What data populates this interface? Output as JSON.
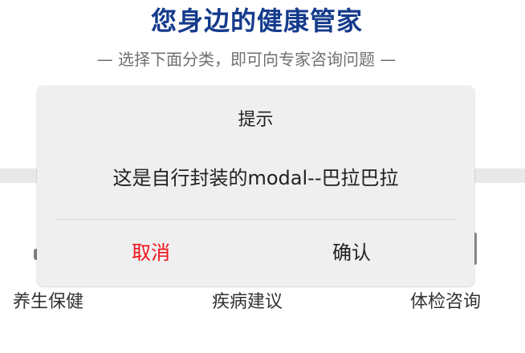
{
  "header": {
    "title": "您身边的健康管家",
    "subtitle": "— 选择下面分类，即可向专家咨询问题 —"
  },
  "categories": [
    {
      "label": "养生保健"
    },
    {
      "label": "疾病建议"
    },
    {
      "label": "体检咨询"
    }
  ],
  "modal": {
    "title": "提示",
    "message": "这是自行封装的modal--巴拉巴拉",
    "cancel_label": "取消",
    "confirm_label": "确认",
    "cancel_color": "#f0131b"
  },
  "colors": {
    "title": "#163b8c",
    "subtitle": "#6f6f6f",
    "modal_background": "#efefef",
    "band": "#e8e8e8"
  }
}
